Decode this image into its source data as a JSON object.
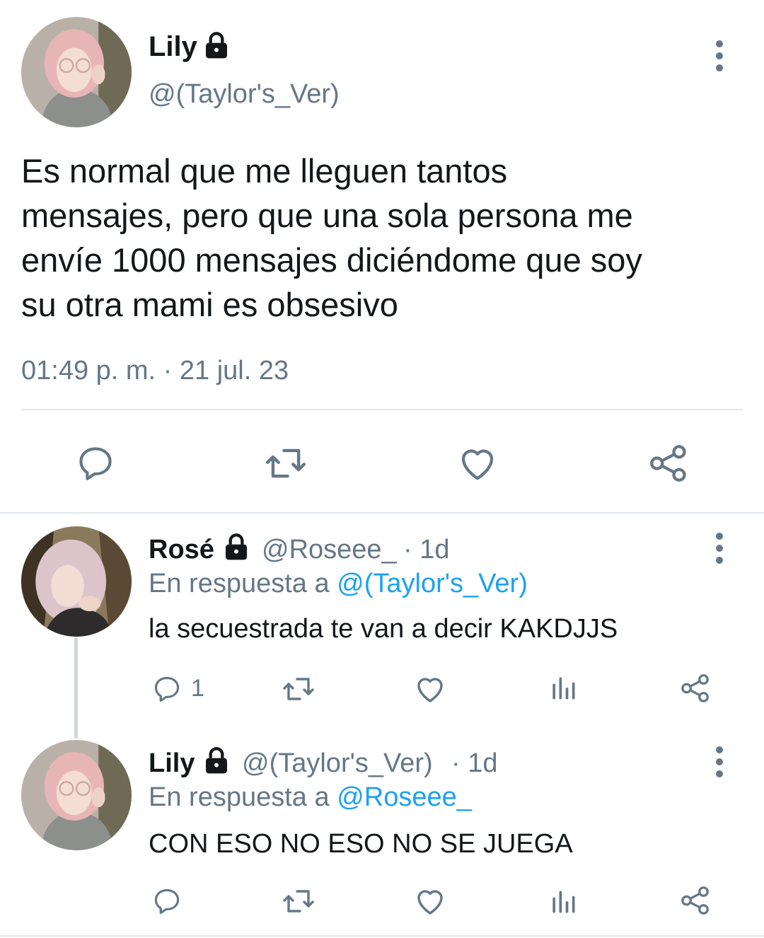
{
  "main_tweet": {
    "author_name": "Lily",
    "author_handle": "@(Taylor's_Ver)",
    "text_lines": [
      "Es normal que me lleguen tantos",
      "mensajes, pero que una sola persona me",
      "envíe 1000 mensajes diciéndome que soy",
      "su otra mami es obsesivo"
    ],
    "timestamp": "01:49 p. m. · 21 jul. 23",
    "actions": [
      "reply-icon",
      "retweet-icon",
      "like-icon",
      "share-icon"
    ]
  },
  "replies": [
    {
      "author_name": "Rosé",
      "author_handle": "@Roseee_",
      "age": "· 1d",
      "reply_prefix": "En respuesta a",
      "reply_to": "@(Taylor's_Ver)",
      "text": "la secuestrada te van a decir KAKDJJS",
      "reply_count": "1"
    },
    {
      "author_name": "Lily",
      "author_handle": "@(Taylor's_Ver)",
      "age": "· 1d",
      "reply_prefix": "En respuesta a",
      "reply_to": "@Roseee_",
      "text": "CON ESO NO ESO NO SE JUEGA",
      "reply_count": ""
    }
  ],
  "colors": {
    "text": "#14171a",
    "muted": "#657786",
    "link": "#1da1f2",
    "divider": "#e1e8ed"
  }
}
